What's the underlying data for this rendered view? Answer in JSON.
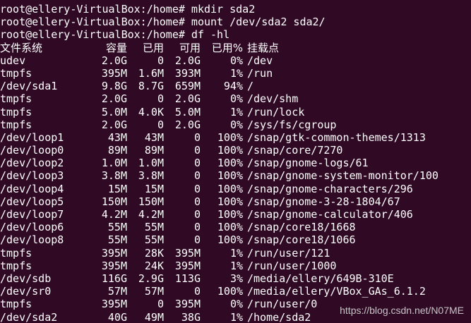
{
  "terminal": {
    "background": "#300a24",
    "foreground": "#ffffff",
    "commands": [
      "root@ellery-VirtualBox:/home# mkdir sda2",
      "root@ellery-VirtualBox:/home# mount /dev/sda2 sda2/",
      "root@ellery-VirtualBox:/home# df -hl"
    ],
    "df_header": {
      "filesystem": "文件系统",
      "size": "容量",
      "used": "已用",
      "avail": "可用",
      "use_pct": "已用%",
      "mounted_on": "挂载点"
    },
    "df_rows": [
      {
        "fs": "udev",
        "size": "2.0G",
        "used": "0",
        "avail": "2.0G",
        "pct": "0%",
        "mnt": "/dev"
      },
      {
        "fs": "tmpfs",
        "size": "395M",
        "used": "1.6M",
        "avail": "393M",
        "pct": "1%",
        "mnt": "/run"
      },
      {
        "fs": "/dev/sda1",
        "size": "9.8G",
        "used": "8.7G",
        "avail": "659M",
        "pct": "94%",
        "mnt": "/"
      },
      {
        "fs": "tmpfs",
        "size": "2.0G",
        "used": "0",
        "avail": "2.0G",
        "pct": "0%",
        "mnt": "/dev/shm"
      },
      {
        "fs": "tmpfs",
        "size": "5.0M",
        "used": "4.0K",
        "avail": "5.0M",
        "pct": "1%",
        "mnt": "/run/lock"
      },
      {
        "fs": "tmpfs",
        "size": "2.0G",
        "used": "0",
        "avail": "2.0G",
        "pct": "0%",
        "mnt": "/sys/fs/cgroup"
      },
      {
        "fs": "/dev/loop1",
        "size": "43M",
        "used": "43M",
        "avail": "0",
        "pct": "100%",
        "mnt": "/snap/gtk-common-themes/1313"
      },
      {
        "fs": "/dev/loop0",
        "size": "89M",
        "used": "89M",
        "avail": "0",
        "pct": "100%",
        "mnt": "/snap/core/7270"
      },
      {
        "fs": "/dev/loop2",
        "size": "1.0M",
        "used": "1.0M",
        "avail": "0",
        "pct": "100%",
        "mnt": "/snap/gnome-logs/61"
      },
      {
        "fs": "/dev/loop3",
        "size": "3.8M",
        "used": "3.8M",
        "avail": "0",
        "pct": "100%",
        "mnt": "/snap/gnome-system-monitor/100"
      },
      {
        "fs": "/dev/loop4",
        "size": "15M",
        "used": "15M",
        "avail": "0",
        "pct": "100%",
        "mnt": "/snap/gnome-characters/296"
      },
      {
        "fs": "/dev/loop5",
        "size": "150M",
        "used": "150M",
        "avail": "0",
        "pct": "100%",
        "mnt": "/snap/gnome-3-28-1804/67"
      },
      {
        "fs": "/dev/loop7",
        "size": "4.2M",
        "used": "4.2M",
        "avail": "0",
        "pct": "100%",
        "mnt": "/snap/gnome-calculator/406"
      },
      {
        "fs": "/dev/loop6",
        "size": "55M",
        "used": "55M",
        "avail": "0",
        "pct": "100%",
        "mnt": "/snap/core18/1668"
      },
      {
        "fs": "/dev/loop8",
        "size": "55M",
        "used": "55M",
        "avail": "0",
        "pct": "100%",
        "mnt": "/snap/core18/1066"
      },
      {
        "fs": "tmpfs",
        "size": "395M",
        "used": "28K",
        "avail": "395M",
        "pct": "1%",
        "mnt": "/run/user/121"
      },
      {
        "fs": "tmpfs",
        "size": "395M",
        "used": "24K",
        "avail": "395M",
        "pct": "1%",
        "mnt": "/run/user/1000"
      },
      {
        "fs": "/dev/sdb",
        "size": "116G",
        "used": "2.9G",
        "avail": "113G",
        "pct": "3%",
        "mnt": "/media/ellery/649B-310E"
      },
      {
        "fs": "/dev/sr0",
        "size": "57M",
        "used": "57M",
        "avail": "0",
        "pct": "100%",
        "mnt": "/media/ellery/VBox_GAs_6.1.2"
      },
      {
        "fs": "tmpfs",
        "size": "395M",
        "used": "0",
        "avail": "395M",
        "pct": "0%",
        "mnt": "/run/user/0"
      },
      {
        "fs": "/dev/sda2",
        "size": "40G",
        "used": "49M",
        "avail": "38G",
        "pct": "1%",
        "mnt": "/home/sda2"
      }
    ]
  },
  "watermark": "https://blog.csdn.net/N07ME"
}
